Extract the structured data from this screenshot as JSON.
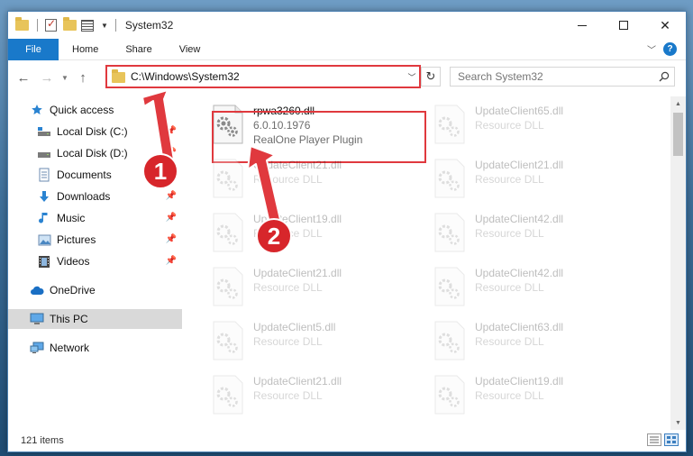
{
  "window": {
    "title": "System32"
  },
  "ribbon": {
    "tabs": [
      "File",
      "Home",
      "Share",
      "View"
    ],
    "help": "?"
  },
  "nav": {
    "address": "C:\\Windows\\System32",
    "search_placeholder": "Search System32"
  },
  "sidebar": {
    "items": [
      {
        "label": "Quick access",
        "icon": "star-icon",
        "pinned": false
      },
      {
        "label": "Local Disk (C:)",
        "icon": "drive-icon",
        "pinned": true
      },
      {
        "label": "Local Disk (D:)",
        "icon": "drive-icon",
        "pinned": true
      },
      {
        "label": "Documents",
        "icon": "documents-icon",
        "pinned": true
      },
      {
        "label": "Downloads",
        "icon": "download-icon",
        "pinned": true
      },
      {
        "label": "Music",
        "icon": "music-icon",
        "pinned": true
      },
      {
        "label": "Pictures",
        "icon": "pictures-icon",
        "pinned": true
      },
      {
        "label": "Videos",
        "icon": "videos-icon",
        "pinned": true
      },
      {
        "label": "OneDrive",
        "icon": "cloud-icon",
        "pinned": false
      },
      {
        "label": "This PC",
        "icon": "computer-icon",
        "pinned": false,
        "selected": true
      },
      {
        "label": "Network",
        "icon": "network-icon",
        "pinned": false
      }
    ]
  },
  "files": {
    "highlighted": {
      "name": "rpwa3260.dll",
      "line2": "6.0.10.1976",
      "line3": "RealOne Player Plugin"
    },
    "left_column": [
      {
        "name": "UpdateClient21.dll",
        "sub": "Resource DLL"
      },
      {
        "name": "UpdateClient19.dll",
        "sub": "Resource DLL"
      },
      {
        "name": "UpdateClient21.dll",
        "sub": "Resource DLL"
      },
      {
        "name": "UpdateClient5.dll",
        "sub": "Resource DLL"
      },
      {
        "name": "UpdateClient21.dll",
        "sub": "Resource DLL"
      }
    ],
    "right_column": [
      {
        "name": "UpdateClient65.dll",
        "sub": "Resource DLL"
      },
      {
        "name": "UpdateClient21.dll",
        "sub": "Resource DLL"
      },
      {
        "name": "UpdateClient42.dll",
        "sub": "Resource DLL"
      },
      {
        "name": "UpdateClient42.dll",
        "sub": "Resource DLL"
      },
      {
        "name": "UpdateClient63.dll",
        "sub": "Resource DLL"
      },
      {
        "name": "UpdateClient19.dll",
        "sub": "Resource DLL"
      }
    ]
  },
  "status": {
    "count": "121 items"
  },
  "annotations": {
    "step1": "1",
    "step2": "2"
  },
  "colors": {
    "accent": "#1979ca",
    "highlight": "#e0393e"
  }
}
